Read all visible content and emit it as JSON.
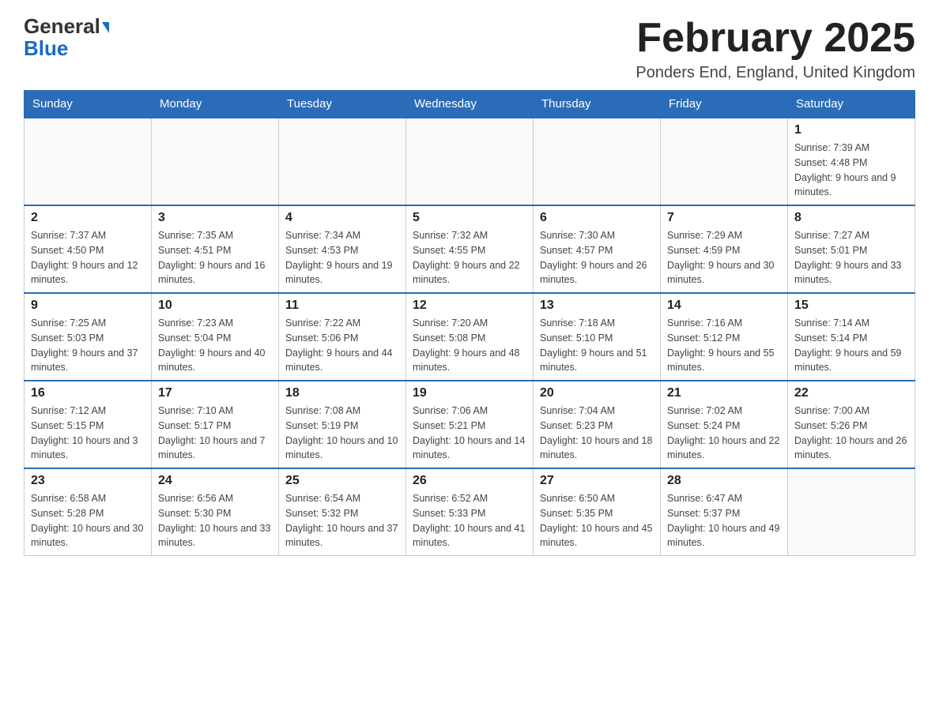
{
  "logo": {
    "general": "General",
    "triangle": "▶",
    "blue": "Blue"
  },
  "title": "February 2025",
  "location": "Ponders End, England, United Kingdom",
  "days_of_week": [
    "Sunday",
    "Monday",
    "Tuesday",
    "Wednesday",
    "Thursday",
    "Friday",
    "Saturday"
  ],
  "weeks": [
    [
      {
        "day": "",
        "info": ""
      },
      {
        "day": "",
        "info": ""
      },
      {
        "day": "",
        "info": ""
      },
      {
        "day": "",
        "info": ""
      },
      {
        "day": "",
        "info": ""
      },
      {
        "day": "",
        "info": ""
      },
      {
        "day": "1",
        "info": "Sunrise: 7:39 AM\nSunset: 4:48 PM\nDaylight: 9 hours and 9 minutes."
      }
    ],
    [
      {
        "day": "2",
        "info": "Sunrise: 7:37 AM\nSunset: 4:50 PM\nDaylight: 9 hours and 12 minutes."
      },
      {
        "day": "3",
        "info": "Sunrise: 7:35 AM\nSunset: 4:51 PM\nDaylight: 9 hours and 16 minutes."
      },
      {
        "day": "4",
        "info": "Sunrise: 7:34 AM\nSunset: 4:53 PM\nDaylight: 9 hours and 19 minutes."
      },
      {
        "day": "5",
        "info": "Sunrise: 7:32 AM\nSunset: 4:55 PM\nDaylight: 9 hours and 22 minutes."
      },
      {
        "day": "6",
        "info": "Sunrise: 7:30 AM\nSunset: 4:57 PM\nDaylight: 9 hours and 26 minutes."
      },
      {
        "day": "7",
        "info": "Sunrise: 7:29 AM\nSunset: 4:59 PM\nDaylight: 9 hours and 30 minutes."
      },
      {
        "day": "8",
        "info": "Sunrise: 7:27 AM\nSunset: 5:01 PM\nDaylight: 9 hours and 33 minutes."
      }
    ],
    [
      {
        "day": "9",
        "info": "Sunrise: 7:25 AM\nSunset: 5:03 PM\nDaylight: 9 hours and 37 minutes."
      },
      {
        "day": "10",
        "info": "Sunrise: 7:23 AM\nSunset: 5:04 PM\nDaylight: 9 hours and 40 minutes."
      },
      {
        "day": "11",
        "info": "Sunrise: 7:22 AM\nSunset: 5:06 PM\nDaylight: 9 hours and 44 minutes."
      },
      {
        "day": "12",
        "info": "Sunrise: 7:20 AM\nSunset: 5:08 PM\nDaylight: 9 hours and 48 minutes."
      },
      {
        "day": "13",
        "info": "Sunrise: 7:18 AM\nSunset: 5:10 PM\nDaylight: 9 hours and 51 minutes."
      },
      {
        "day": "14",
        "info": "Sunrise: 7:16 AM\nSunset: 5:12 PM\nDaylight: 9 hours and 55 minutes."
      },
      {
        "day": "15",
        "info": "Sunrise: 7:14 AM\nSunset: 5:14 PM\nDaylight: 9 hours and 59 minutes."
      }
    ],
    [
      {
        "day": "16",
        "info": "Sunrise: 7:12 AM\nSunset: 5:15 PM\nDaylight: 10 hours and 3 minutes."
      },
      {
        "day": "17",
        "info": "Sunrise: 7:10 AM\nSunset: 5:17 PM\nDaylight: 10 hours and 7 minutes."
      },
      {
        "day": "18",
        "info": "Sunrise: 7:08 AM\nSunset: 5:19 PM\nDaylight: 10 hours and 10 minutes."
      },
      {
        "day": "19",
        "info": "Sunrise: 7:06 AM\nSunset: 5:21 PM\nDaylight: 10 hours and 14 minutes."
      },
      {
        "day": "20",
        "info": "Sunrise: 7:04 AM\nSunset: 5:23 PM\nDaylight: 10 hours and 18 minutes."
      },
      {
        "day": "21",
        "info": "Sunrise: 7:02 AM\nSunset: 5:24 PM\nDaylight: 10 hours and 22 minutes."
      },
      {
        "day": "22",
        "info": "Sunrise: 7:00 AM\nSunset: 5:26 PM\nDaylight: 10 hours and 26 minutes."
      }
    ],
    [
      {
        "day": "23",
        "info": "Sunrise: 6:58 AM\nSunset: 5:28 PM\nDaylight: 10 hours and 30 minutes."
      },
      {
        "day": "24",
        "info": "Sunrise: 6:56 AM\nSunset: 5:30 PM\nDaylight: 10 hours and 33 minutes."
      },
      {
        "day": "25",
        "info": "Sunrise: 6:54 AM\nSunset: 5:32 PM\nDaylight: 10 hours and 37 minutes."
      },
      {
        "day": "26",
        "info": "Sunrise: 6:52 AM\nSunset: 5:33 PM\nDaylight: 10 hours and 41 minutes."
      },
      {
        "day": "27",
        "info": "Sunrise: 6:50 AM\nSunset: 5:35 PM\nDaylight: 10 hours and 45 minutes."
      },
      {
        "day": "28",
        "info": "Sunrise: 6:47 AM\nSunset: 5:37 PM\nDaylight: 10 hours and 49 minutes."
      },
      {
        "day": "",
        "info": ""
      }
    ]
  ]
}
